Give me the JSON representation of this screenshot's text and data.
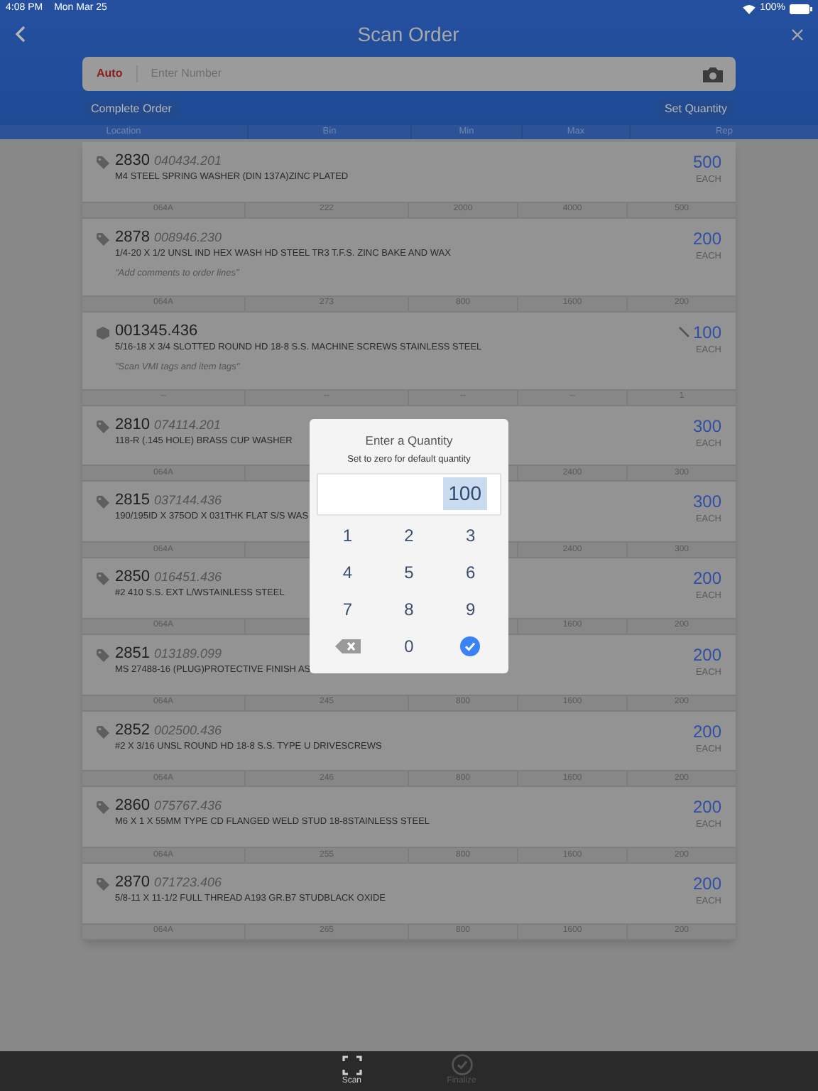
{
  "status_bar": {
    "time": "4:08 PM",
    "date": "Mon Mar 25",
    "battery": "100%"
  },
  "header": {
    "title": "Scan Order"
  },
  "scan_field": {
    "mode": "Auto",
    "placeholder": "Enter Number"
  },
  "actions": [
    "Complete Order",
    "Set Quantity"
  ],
  "columns": [
    "Location",
    "Bin",
    "Min",
    "Max",
    "Rep"
  ],
  "items": [
    {
      "kind": "tag",
      "number": "2830",
      "part": "040434.201",
      "description": "M4 STEEL SPRING WASHER (DIN 137A)ZINC PLATED",
      "quantity": "500",
      "unit": "EACH",
      "edited": false,
      "cells": {
        "location": "064A",
        "bin": "222",
        "min": "2000",
        "max": "4000",
        "rep": "500"
      }
    },
    {
      "kind": "tag",
      "number": "2878",
      "part": "008946.230",
      "description": "1/4-20 X 1/2 UNSL IND HEX WASH HD STEEL TR3 T.F.S. ZINC BAKE AND WAX",
      "comment": "\"Add comments to order lines\"",
      "quantity": "200",
      "unit": "EACH",
      "edited": false,
      "cells": {
        "location": "064A",
        "bin": "273",
        "min": "800",
        "max": "1600",
        "rep": "200"
      }
    },
    {
      "kind": "box",
      "number": "001345.436",
      "description": "5/16-18 X 3/4 SLOTTED ROUND HD 18-8 S.S. MACHINE SCREWS STAINLESS STEEL",
      "comment": "\"Scan VMI tags and item tags\"",
      "quantity": "100",
      "unit": "EACH",
      "edited": true,
      "cells": {
        "location": "--",
        "bin": "--",
        "min": "--",
        "max": "--",
        "rep": "1"
      }
    },
    {
      "kind": "tag",
      "number": "2810",
      "part": "074114.201",
      "description": "118-R (.145 HOLE) BRASS CUP WASHER",
      "quantity": "300",
      "unit": "EACH",
      "edited": false,
      "cells": {
        "location": "064A",
        "max": "2400",
        "rep": "300"
      }
    },
    {
      "kind": "tag",
      "number": "2815",
      "part": "037144.436",
      "description": "190/195ID X 375OD X 031THK FLAT S/S WAS",
      "quantity": "300",
      "unit": "EACH",
      "edited": false,
      "cells": {
        "location": "064A",
        "max": "2400",
        "rep": "300"
      }
    },
    {
      "kind": "tag",
      "number": "2850",
      "part": "016451.436",
      "description": "#2 410 S.S. EXT L/WSTAINLESS STEEL",
      "quantity": "200",
      "unit": "EACH",
      "edited": false,
      "cells": {
        "location": "064A",
        "max": "1600",
        "rep": "200"
      }
    },
    {
      "kind": "tag",
      "number": "2851",
      "part": "013189.099",
      "description": "MS 27488-16 (PLUG)PROTECTIVE FINISH AS",
      "quantity": "200",
      "unit": "EACH",
      "edited": false,
      "cells": {
        "location": "064A",
        "bin": "245",
        "min": "800",
        "max": "1600",
        "rep": "200"
      }
    },
    {
      "kind": "tag",
      "number": "2852",
      "part": "002500.436",
      "description": "#2 X 3/16 UNSL ROUND HD 18-8 S.S. TYPE U DRIVESCREWS",
      "quantity": "200",
      "unit": "EACH",
      "edited": false,
      "cells": {
        "location": "064A",
        "bin": "246",
        "min": "800",
        "max": "1600",
        "rep": "200"
      }
    },
    {
      "kind": "tag",
      "number": "2860",
      "part": "075767.436",
      "description": "M6 X 1 X 55MM TYPE CD FLANGED WELD STUD 18-8STAINLESS STEEL",
      "quantity": "200",
      "unit": "EACH",
      "edited": false,
      "cells": {
        "location": "064A",
        "bin": "255",
        "min": "800",
        "max": "1600",
        "rep": "200"
      }
    },
    {
      "kind": "tag",
      "number": "2870",
      "part": "071723.406",
      "description": "5/8-11 X 11-1/2 FULL THREAD A193 GR.B7 STUDBLACK OXIDE",
      "quantity": "200",
      "unit": "EACH",
      "edited": false,
      "cells": {
        "location": "064A",
        "bin": "265",
        "min": "800",
        "max": "1600",
        "rep": "200"
      }
    }
  ],
  "dialog": {
    "title": "Enter a Quantity",
    "subtitle": "Set to zero for default quantity",
    "value": "100",
    "value_selected": true,
    "keys": [
      {
        "kind": "digit",
        "label": "1"
      },
      {
        "kind": "digit",
        "label": "2"
      },
      {
        "kind": "digit",
        "label": "3"
      },
      {
        "kind": "digit",
        "label": "4"
      },
      {
        "kind": "digit",
        "label": "5"
      },
      {
        "kind": "digit",
        "label": "6"
      },
      {
        "kind": "digit",
        "label": "7"
      },
      {
        "kind": "digit",
        "label": "8"
      },
      {
        "kind": "digit",
        "label": "9"
      },
      {
        "kind": "backspace"
      },
      {
        "kind": "digit",
        "label": "0"
      },
      {
        "kind": "confirm"
      }
    ]
  },
  "tab_bar": [
    {
      "kind": "scan",
      "label": "Scan",
      "disabled": false
    },
    {
      "kind": "finalize",
      "label": "Finalize",
      "disabled": true
    }
  ]
}
